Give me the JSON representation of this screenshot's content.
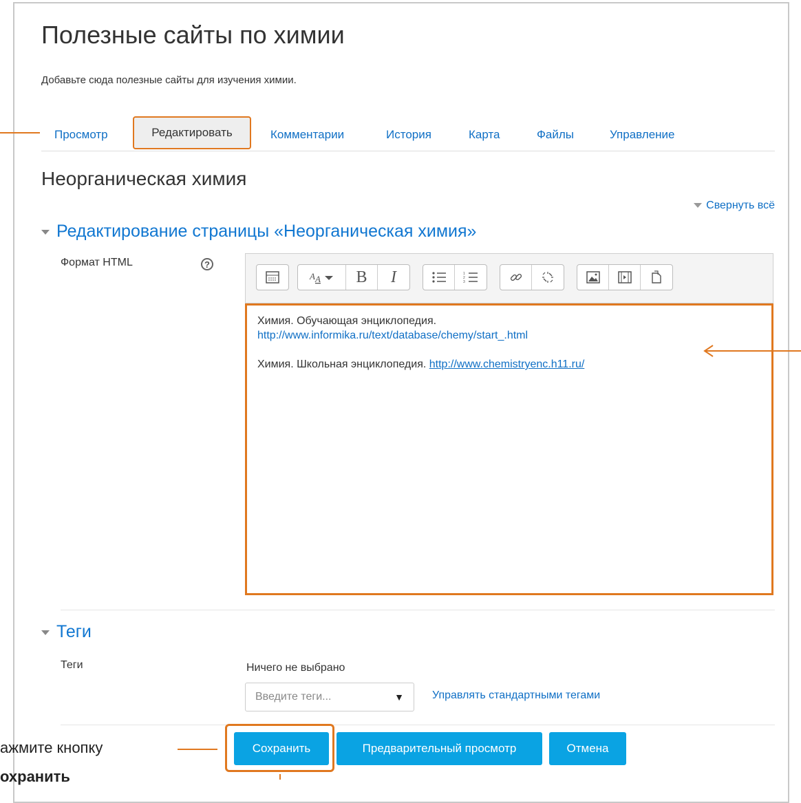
{
  "page": {
    "title": "Полезные сайты по химии",
    "description": "Добавьте сюда полезные сайты для изучения химии."
  },
  "tabs": [
    {
      "label": "Просмотр"
    },
    {
      "label": "Редактировать"
    },
    {
      "label": "Комментарии"
    },
    {
      "label": "История"
    },
    {
      "label": "Карта"
    },
    {
      "label": "Файлы"
    },
    {
      "label": "Управление"
    }
  ],
  "section": {
    "title": "Неорганическая химия",
    "collapse_all": "Свернуть всё",
    "edit_legend": "Редактирование страницы «Неорганическая химия»"
  },
  "format": {
    "label": "Формат HTML",
    "help_icon": "question-circle-icon"
  },
  "toolbar": {
    "groups": [
      [
        "toolbar-toggle-icon"
      ],
      [
        "font-style-icon",
        "bold-icon",
        "italic-icon"
      ],
      [
        "unordered-list-icon",
        "ordered-list-icon"
      ],
      [
        "link-icon",
        "unlink-icon"
      ],
      [
        "image-icon",
        "media-icon",
        "files-icon"
      ]
    ],
    "bold_glyph": "B",
    "italic_glyph": "I"
  },
  "editor": {
    "line1": "Химия. Обучающая энциклопедия.",
    "link1": "http://www.informika.ru/text/database/chemy/start_.html",
    "line2_prefix": "Химия. Школьная энциклопедия. ",
    "link2": "http://www.chemistryenc.h11.ru/"
  },
  "tags": {
    "legend": "Теги",
    "label": "Теги",
    "selected": "Ничего не выбрано",
    "placeholder": "Введите теги...",
    "manage_link": "Управлять стандартными тегами"
  },
  "buttons": {
    "save": "Сохранить",
    "preview": "Предварительный просмотр",
    "cancel": "Отмена"
  },
  "annotation": {
    "callout_line1": "ажмите кнопку",
    "callout_line2": "охранить"
  },
  "colors": {
    "accent": "#0aa3e3",
    "link": "#0f6fc5",
    "highlight": "#e0781f"
  }
}
